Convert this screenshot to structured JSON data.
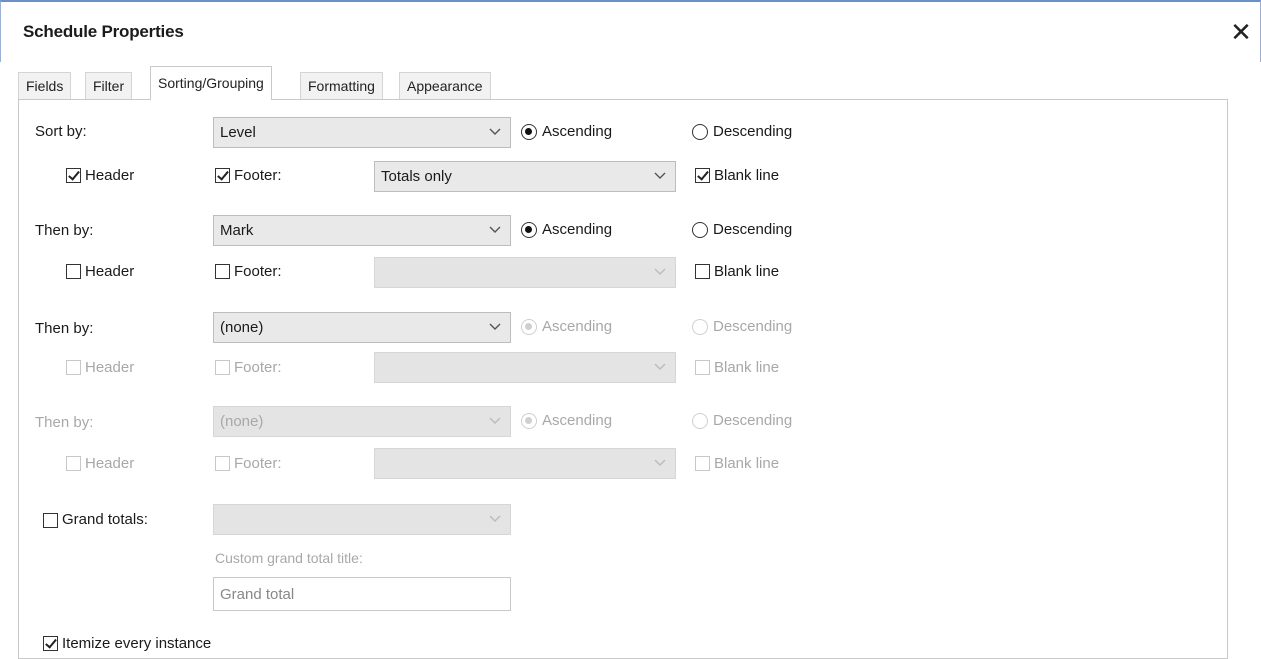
{
  "window": {
    "title": "Schedule Properties",
    "close_glyph": "✕"
  },
  "tabs": [
    {
      "label": "Fields"
    },
    {
      "label": "Filter"
    },
    {
      "label": "Sorting/Grouping"
    },
    {
      "label": "Formatting"
    },
    {
      "label": "Appearance"
    }
  ],
  "groups": [
    {
      "label": "Sort by:",
      "field": "Level",
      "order": "Ascending",
      "ascending_label": "Ascending",
      "descending_label": "Descending",
      "header_label": "Header",
      "header_checked": true,
      "footer_label": "Footer:",
      "footer_checked": true,
      "footer_value": "Totals only",
      "blank_line_label": "Blank line",
      "blank_line_checked": true
    },
    {
      "label": "Then by:",
      "field": "Mark",
      "order": "Ascending",
      "ascending_label": "Ascending",
      "descending_label": "Descending",
      "header_label": "Header",
      "header_checked": false,
      "footer_label": "Footer:",
      "footer_checked": false,
      "footer_value": "",
      "blank_line_label": "Blank line",
      "blank_line_checked": false
    },
    {
      "label": "Then by:",
      "field": "(none)",
      "order": "Ascending",
      "ascending_label": "Ascending",
      "descending_label": "Descending",
      "header_label": "Header",
      "header_checked": false,
      "footer_label": "Footer:",
      "footer_checked": false,
      "footer_value": "",
      "blank_line_label": "Blank line",
      "blank_line_checked": false
    },
    {
      "label": "Then by:",
      "field": "(none)",
      "order": "Ascending",
      "ascending_label": "Ascending",
      "descending_label": "Descending",
      "header_label": "Header",
      "header_checked": false,
      "footer_label": "Footer:",
      "footer_checked": false,
      "footer_value": "",
      "blank_line_label": "Blank line",
      "blank_line_checked": false
    }
  ],
  "grand_totals": {
    "label": "Grand totals:",
    "checked": false,
    "value": "",
    "custom_title_label": "Custom grand total title:",
    "custom_title_value": "Grand total"
  },
  "itemize": {
    "label": "Itemize every instance",
    "checked": true
  }
}
